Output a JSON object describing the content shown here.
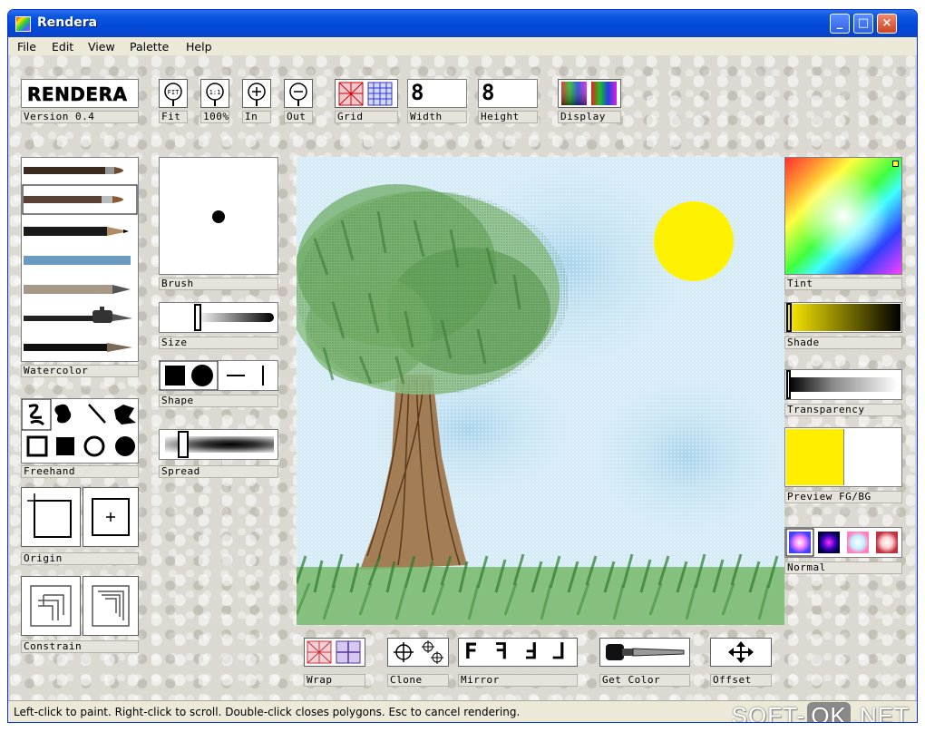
{
  "window": {
    "title": "Rendera",
    "minimize": "_",
    "maximize": "□",
    "close": "×"
  },
  "menu": [
    "File",
    "Edit",
    "View",
    "Palette",
    "Help"
  ],
  "logo": {
    "text": "RENDERA",
    "version": "Version 0.4"
  },
  "toolbar": {
    "fit": "Fit",
    "zoom100": "100%",
    "zoom_in": "In",
    "zoom_out": "Out",
    "grid": "Grid",
    "width_label": "Width",
    "width_value": "8",
    "height_label": "Height",
    "height_value": "8",
    "display": "Display"
  },
  "left_panel": {
    "brush_set": "Watercolor",
    "shape_tool": "Freehand",
    "origin": "Origin",
    "constrain": "Constrain"
  },
  "brush_panel": {
    "brush": "Brush",
    "size": "Size",
    "shape": "Shape",
    "spread": "Spread"
  },
  "right_panel": {
    "tint": "Tint",
    "shade": "Shade",
    "transparency": "Transparency",
    "preview": "Preview FG/BG",
    "mode": "Normal",
    "fg_color": "#ffee00",
    "bg_color": "#ffffff"
  },
  "bottom_tools": {
    "wrap": "Wrap",
    "clone": "Clone",
    "mirror": "Mirror",
    "mirror_glyphs": [
      "F",
      "ꟻ",
      "Ⅎ",
      "⅃"
    ],
    "get_color": "Get Color",
    "offset": "Offset"
  },
  "status": "Left-click to paint. Right-click to scroll. Double-click closes polygons. Esc to cancel rendering.",
  "watermark": {
    "left": "SOFT-",
    "mid": "OK",
    "right": ".NET"
  }
}
